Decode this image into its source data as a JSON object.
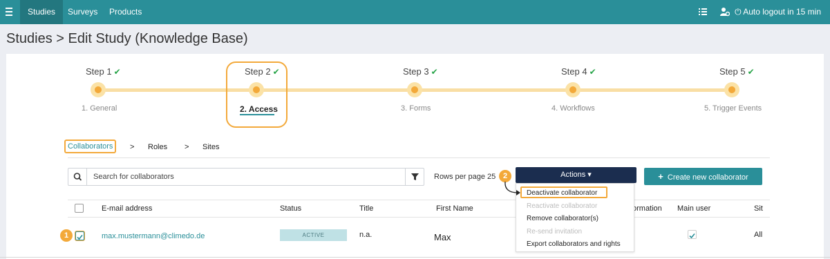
{
  "nav": {
    "items": [
      {
        "label": "Studies",
        "active": true
      },
      {
        "label": "Surveys",
        "active": false
      },
      {
        "label": "Products",
        "active": false
      }
    ],
    "autologout": "Auto logout in 15 min",
    "icons": [
      "menu-icon",
      "list-icon",
      "user-settings-icon",
      "power-icon"
    ]
  },
  "page": {
    "title": "Studies > Edit Study (Knowledge Base)"
  },
  "stepper": {
    "steps": [
      {
        "label": "Step 1",
        "sub": "1. General",
        "done": true,
        "active": false
      },
      {
        "label": "Step 2",
        "sub": "2. Access",
        "done": true,
        "active": true
      },
      {
        "label": "Step 3",
        "sub": "3. Forms",
        "done": true,
        "active": false
      },
      {
        "label": "Step 4",
        "sub": "4. Workflows",
        "done": true,
        "active": false
      },
      {
        "label": "Step 5",
        "sub": "5. Trigger Events",
        "done": true,
        "active": false
      }
    ],
    "check": "✔"
  },
  "subtabs": {
    "items": [
      "Collaborators",
      "Roles",
      "Sites"
    ],
    "separator": ">"
  },
  "toolbar": {
    "search_placeholder": "Search for collaborators",
    "rows_per_page": "Rows per page 25",
    "actions_label": "Actions ▾",
    "create_label": "Create new collaborator",
    "create_plus": "+"
  },
  "badges": [
    "1",
    "2"
  ],
  "dropdown": {
    "items": [
      {
        "label": "Deactivate collaborator",
        "disabled": false
      },
      {
        "label": "Reactivate collaborator",
        "disabled": true
      },
      {
        "label": "Remove collaborator(s)",
        "disabled": false
      },
      {
        "label": "Re-send invitation",
        "disabled": true
      },
      {
        "label": "Export collaborators and rights",
        "disabled": false
      }
    ]
  },
  "table": {
    "columns": [
      "E-mail address",
      "Status",
      "Title",
      "First Name",
      "ormation",
      "Main user",
      "Sit"
    ],
    "rows": [
      {
        "email": "max.mustermann@climedo.de",
        "status": "ACTIVE",
        "title": "n.a.",
        "first_name": "Max",
        "site": "All",
        "main_user": true,
        "selected": true
      }
    ]
  },
  "colors": {
    "primary": "#2a8f99",
    "navy": "#1b2d4f",
    "highlight": "#f3a93a",
    "success": "#29a54a"
  }
}
